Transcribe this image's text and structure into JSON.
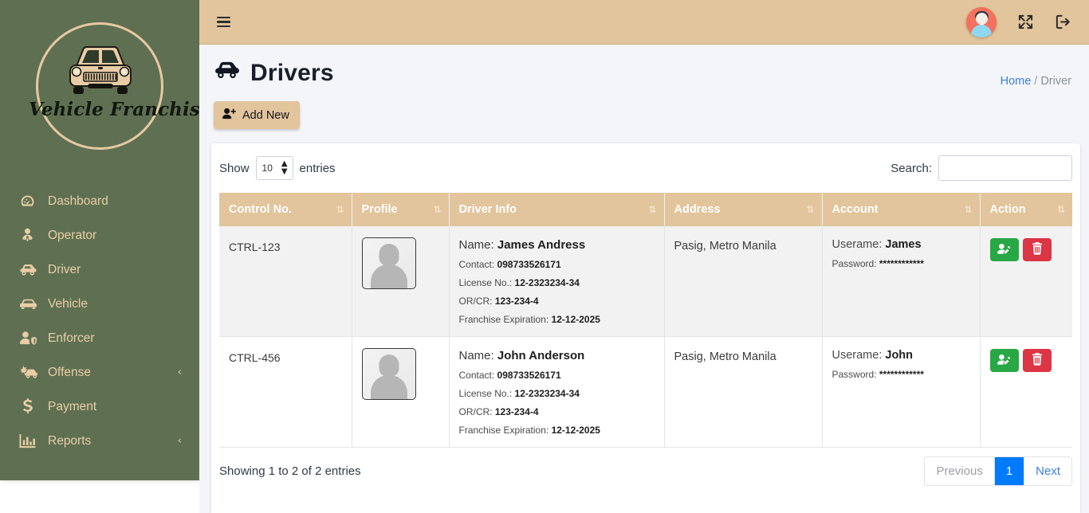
{
  "brand": {
    "logo_text": "Vehicle Franchising",
    "logo_icon": "car-front-icon"
  },
  "sidebar": {
    "items": [
      {
        "label": "Dashboard",
        "icon": "gauge-icon",
        "caret": ""
      },
      {
        "label": "Operator",
        "icon": "user-tie-icon",
        "caret": ""
      },
      {
        "label": "Driver",
        "icon": "car-side-icon",
        "caret": ""
      },
      {
        "label": "Vehicle",
        "icon": "car-icon",
        "caret": ""
      },
      {
        "label": "Enforcer",
        "icon": "user-shield-icon",
        "caret": ""
      },
      {
        "label": "Offense",
        "icon": "car-crash-icon",
        "caret": "‹"
      },
      {
        "label": "Payment",
        "icon": "dollar-icon",
        "caret": ""
      },
      {
        "label": "Reports",
        "icon": "bar-chart-icon",
        "caret": "‹"
      }
    ]
  },
  "topbar": {
    "menu_icon": "hamburger-icon",
    "avatar_icon": "user-avatar",
    "fullscreen_icon": "expand-arrows-icon",
    "logout_icon": "sign-out-icon"
  },
  "page": {
    "title": "Drivers",
    "title_icon": "car-side-icon",
    "breadcrumb": {
      "home": "Home",
      "separator": "/",
      "current": "Driver"
    },
    "add_new_label": "Add New",
    "add_new_icon": "user-plus-icon"
  },
  "datatable": {
    "show_label": "Show",
    "entries_label": "entries",
    "page_length": "10",
    "search_label": "Search:",
    "search_value": "",
    "search_placeholder": "",
    "sort_icon": "⇅",
    "columns": [
      "Control No.",
      "Profile",
      "Driver Info",
      "Address",
      "Account",
      "Action"
    ],
    "field_labels": {
      "name": "Name:",
      "contact": "Contact:",
      "license": "License No.:",
      "orcr": "OR/CR:",
      "franchise": "Franchise Expiration:",
      "username": "Userame:",
      "password": "Password:"
    },
    "rows": [
      {
        "control_no": "CTRL-123",
        "profile_icon": "profile-placeholder",
        "name": "James Andress",
        "contact": "098733526171",
        "license_no": "12-2323234-34",
        "orcr": "123-234-4",
        "franchise_expiration": "12-12-2025",
        "address": "Pasig, Metro Manila",
        "username": "James",
        "password": "************",
        "edit_icon": "user-edit-icon",
        "delete_icon": "trash-icon"
      },
      {
        "control_no": "CTRL-456",
        "profile_icon": "profile-placeholder",
        "name": "John Anderson",
        "contact": "098733526171",
        "license_no": "12-2323234-34",
        "orcr": "123-234-4",
        "franchise_expiration": "12-12-2025",
        "address": "Pasig, Metro Manila",
        "username": "John",
        "password": "************",
        "edit_icon": "user-edit-icon",
        "delete_icon": "trash-icon"
      }
    ],
    "showing_text": "Showing 1 to 2 of 2 entries",
    "pagination": {
      "previous": "Previous",
      "pages": [
        "1"
      ],
      "next": "Next",
      "active": "1"
    }
  },
  "colors": {
    "sidebar": "#5f7052",
    "accent_tan": "#e2c59c",
    "content_bg": "#f4f5f9",
    "link_blue": "#3b7ddd",
    "active_page": "#007bff",
    "edit_green": "#28a745",
    "delete_red": "#dc3545"
  }
}
